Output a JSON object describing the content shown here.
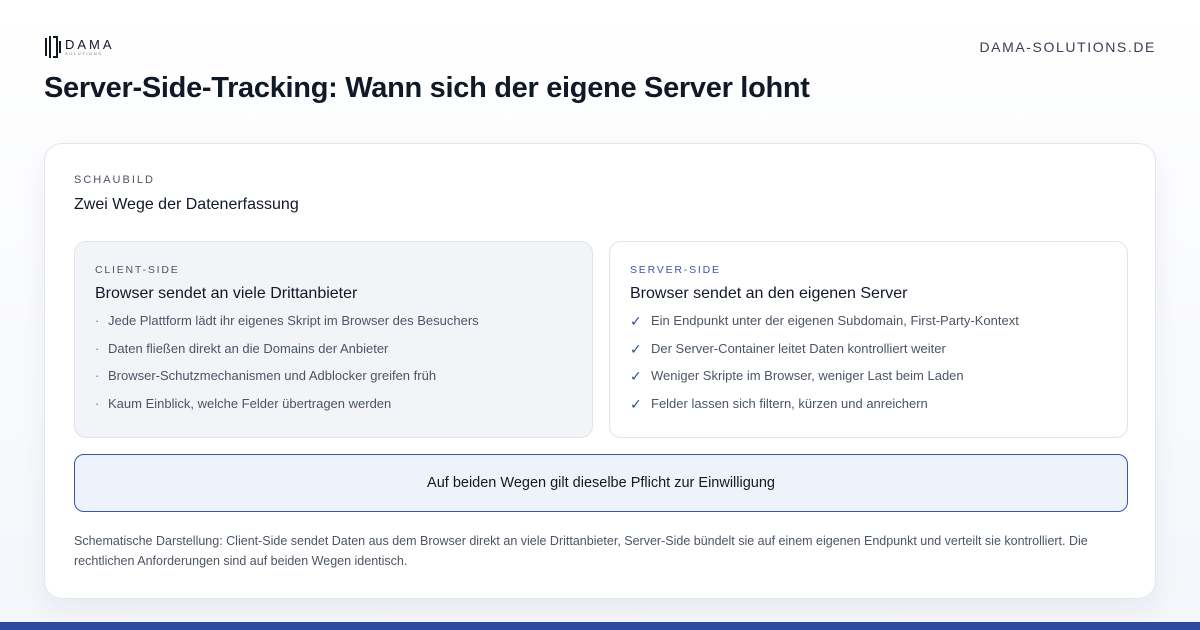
{
  "header": {
    "logo_text": "DAMA",
    "logo_subtext": "SOLUTIONS",
    "domain": "DAMA-SOLUTIONS.DE"
  },
  "page": {
    "title": "Server-Side-Tracking: Wann sich der eigene Server lohnt"
  },
  "card": {
    "eyebrow": "SCHAUBILD",
    "title": "Zwei Wege der Datenerfassung",
    "client": {
      "label": "CLIENT-SIDE",
      "title": "Browser sendet an viele Drittanbieter",
      "bullet_symbol": "·",
      "items": [
        "Jede Plattform lädt ihr eigenes Skript im Browser des Besuchers",
        "Daten fließen direkt an die Domains der Anbieter",
        "Browser-Schutzmechanismen und Adblocker greifen früh",
        "Kaum Einblick, welche Felder übertragen werden"
      ]
    },
    "server": {
      "label": "SERVER-SIDE",
      "title": "Browser sendet an den eigenen Server",
      "check_symbol": "✓",
      "items": [
        "Ein Endpunkt unter der eigenen Subdomain, First-Party-Kontext",
        "Der Server-Container leitet Daten kontrolliert weiter",
        "Weniger Skripte im Browser, weniger Last beim Laden",
        "Felder lassen sich filtern, kürzen und anreichern"
      ]
    },
    "banner": "Auf beiden Wegen gilt dieselbe Pflicht zur Einwilligung",
    "caption": "Schematische Darstellung: Client-Side sendet Daten aus dem Browser direkt an viele Drittanbieter, Server-Side bündelt sie auf einem eigenen Endpunkt und verteilt sie kontrolliert. Die rechtlichen Anforderungen sind auf beiden Wegen identisch."
  },
  "colors": {
    "accent": "#2e4a9e",
    "banner_background": "#eef2fa",
    "client_panel_background": "#f3f4f8"
  },
  "icons": {
    "logo": "dama-logo-mark",
    "client_bullet": "dot-bullet",
    "server_bullet": "check-icon"
  }
}
